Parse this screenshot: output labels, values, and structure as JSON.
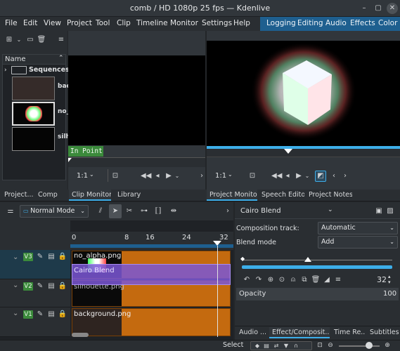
{
  "window": {
    "title": "comb / HD 1080p 25 fps — Kdenlive"
  },
  "menubar": {
    "items": [
      "File",
      "Edit",
      "View",
      "Project",
      "Tool",
      "Clip",
      "Timeline",
      "Monitor",
      "Settings",
      "Help"
    ],
    "layouts": [
      "Logging",
      "Editing",
      "Audio",
      "Effects",
      "Color"
    ]
  },
  "bin": {
    "column_name": "Name",
    "folder": "Sequences",
    "clips": [
      "bac",
      "no_",
      "silh"
    ]
  },
  "clip_monitor": {
    "in_point_label": "In Point",
    "zoom": "1:1"
  },
  "project_monitor": {
    "zoom": "1:1"
  },
  "tabs_left": [
    "Project...",
    "Comp",
    "Clip Monitor",
    "Library"
  ],
  "tabs_right": [
    "Project Monitor",
    "Speech Editor",
    "Project Notes"
  ],
  "timeline": {
    "mode": "Normal Mode",
    "ruler_labels": [
      "0",
      "8",
      "16",
      "24",
      "32"
    ],
    "tracks": [
      {
        "badge": "V3",
        "clip": "no_alpha.png"
      },
      {
        "badge": "V2",
        "clip": "silhouette.png"
      },
      {
        "badge": "V1",
        "clip": "background.png"
      }
    ],
    "composition_label": "Cairo Blend"
  },
  "effect_panel": {
    "effect_name": "Cairo Blend",
    "composition_track_label": "Composition track:",
    "composition_track_value": "Automatic",
    "blend_mode_label": "Blend mode",
    "blend_mode_value": "Add",
    "frame_value": "32",
    "param_name": "Opacity",
    "param_value": "100",
    "tabs": [
      "Audio ...",
      "Effect/Composit...",
      "Time Re...",
      "Subtitles"
    ]
  },
  "statusbar": {
    "mode": "Select"
  },
  "colors": {
    "accent": "#3daee9",
    "layout_bar": "#1e5f8f",
    "clip": "#c46a0f",
    "composition": "#7b57d6",
    "track_badge": "#3b8a3b"
  }
}
